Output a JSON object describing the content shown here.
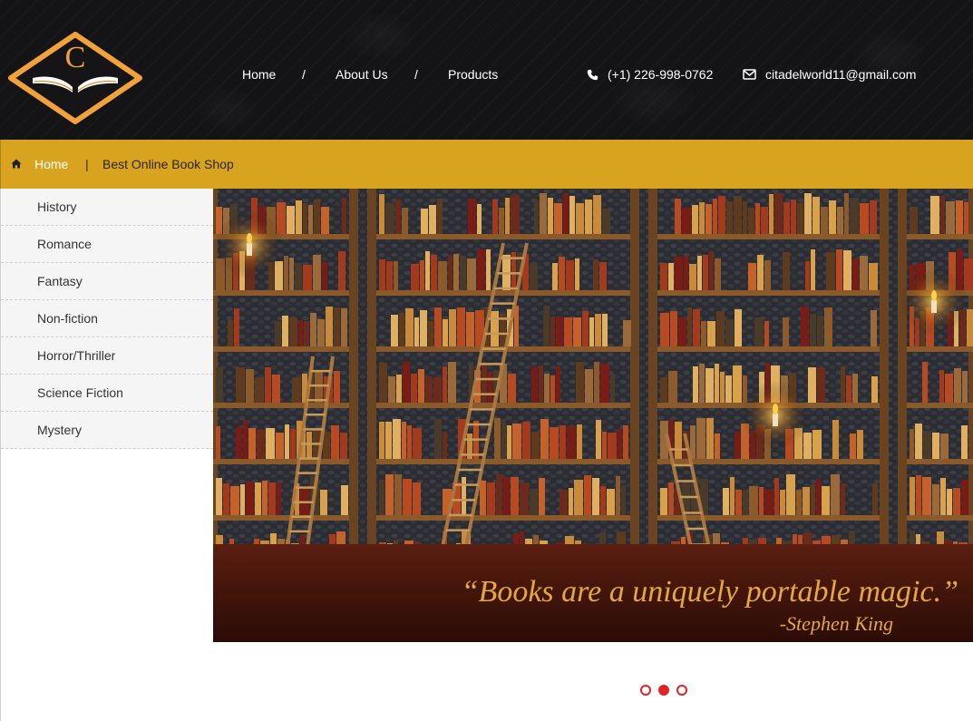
{
  "header": {
    "logo_letter": "C",
    "nav": [
      {
        "label": "Home"
      },
      {
        "label": "About Us"
      },
      {
        "label": "Products"
      }
    ],
    "nav_separator": "/",
    "phone": "(+1) 226-998-0762",
    "email": "citadelworld11@gmail.com"
  },
  "breadcrumb": {
    "home": "Home",
    "separator": "|",
    "current": "Best Online Book Shop"
  },
  "sidebar": {
    "categories": [
      {
        "label": "History"
      },
      {
        "label": "Romance"
      },
      {
        "label": "Fantasy"
      },
      {
        "label": "Non-fiction"
      },
      {
        "label": "Horror/Thriller"
      },
      {
        "label": "Science Fiction"
      },
      {
        "label": "Mystery"
      }
    ]
  },
  "banner": {
    "quote": "“Books are a uniquely portable magic.”",
    "author": "-Stephen King"
  },
  "slider": {
    "slide_count": 3,
    "active_index": 1
  },
  "colors": {
    "header_bg": "#141416",
    "breadcrumb_bg": "#d8a41f",
    "logo_orange": "#f2a23a",
    "dot_red": "#e02424"
  },
  "icons": {
    "phone": "phone-icon",
    "email": "envelope-icon",
    "home": "home-icon"
  }
}
